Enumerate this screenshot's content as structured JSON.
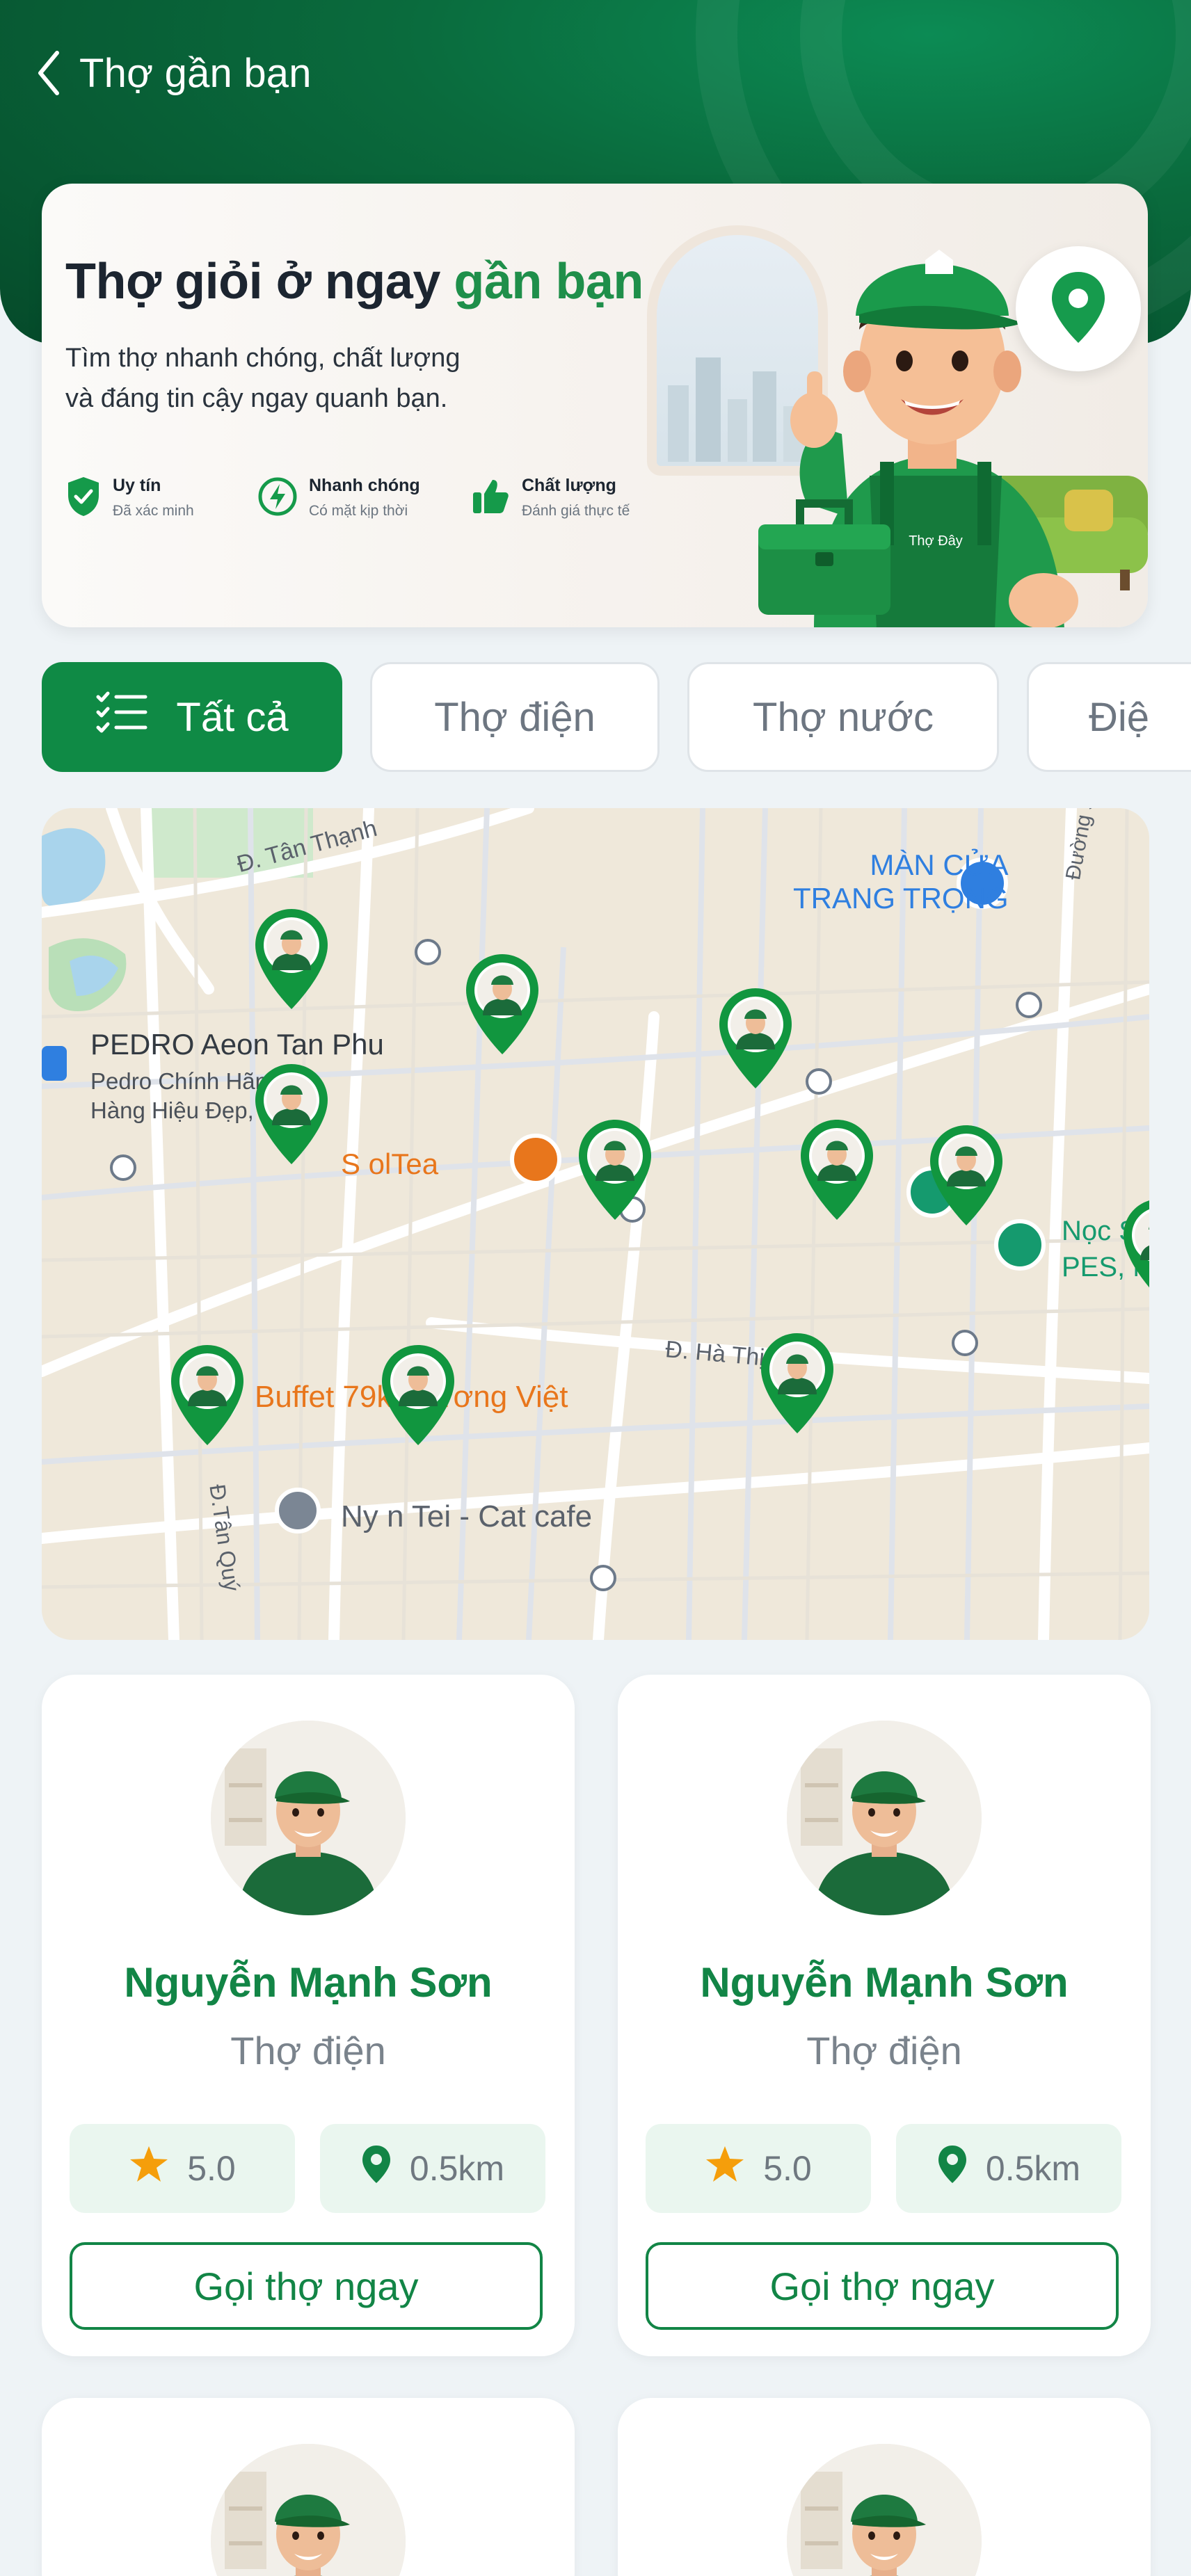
{
  "header": {
    "title": "Thợ gần bạn"
  },
  "banner": {
    "title_part1": "Thợ giỏi ở ngay ",
    "title_highlight": "gần bạn",
    "subtitle_line1": "Tìm thợ nhanh chóng, chất lượng",
    "subtitle_line2": "và đáng tin cậy ngay quanh bạn.",
    "features": [
      {
        "title": "Uy tín",
        "desc": "Đã xác minh",
        "icon": "shield-check-icon"
      },
      {
        "title": "Nhanh chóng",
        "desc": "Có mặt kịp thời",
        "icon": "bolt-icon"
      },
      {
        "title": "Chất lượng",
        "desc": "Đánh giá thực tế",
        "icon": "thumbs-up-icon"
      }
    ],
    "shirt_logo": "Thợ Đây"
  },
  "filters": {
    "chips": [
      {
        "label": "Tất cả",
        "active": true
      },
      {
        "label": "Thợ điện",
        "active": false
      },
      {
        "label": "Thợ nước",
        "active": false
      },
      {
        "label": "Điệ",
        "active": false
      }
    ]
  },
  "map": {
    "labels": {
      "street1": "Đ. Tân Thạnh",
      "poi_door_line1": "MÀN CỬA",
      "poi_door_line2": "TRANG TRỌNG",
      "street_right": "Đường s",
      "poi_pedro": "PEDRO Aeon Tan Phu",
      "poi_pedro_sub1": "Pedro Chính Hãng -",
      "poi_pedro_sub2": "Hàng Hiệu Đẹp, Giá ...",
      "poi_tea": "S     olTea",
      "poi_noc1": "Nọc S",
      "poi_noc2": "PES, N",
      "street2": "Đ. Hà Thị Đát",
      "poi_buffet": "Buffet 79k- Hương Việt",
      "street3": "Đ.Tân Quý",
      "poi_cafe": "Ny   n Tei - Cat cafe"
    },
    "colors": {
      "pin": "#11963f",
      "poi_orange": "#e8761c",
      "poi_blue": "#2f7fe0",
      "poi_teal": "#159a6e"
    }
  },
  "workers": [
    {
      "name": "Nguyễn Mạnh Sơn",
      "role": "Thợ điện",
      "rating": "5.0",
      "distance": "0.5km",
      "cta": "Gọi thợ ngay"
    },
    {
      "name": "Nguyễn Mạnh Sơn",
      "role": "Thợ điện",
      "rating": "5.0",
      "distance": "0.5km",
      "cta": "Gọi thợ ngay"
    },
    {
      "name": "",
      "role": "",
      "rating": "",
      "distance": "",
      "cta": ""
    },
    {
      "name": "",
      "role": "",
      "rating": "",
      "distance": "",
      "cta": ""
    }
  ],
  "theme": {
    "brand_green": "#0f8a45",
    "header_green": "#0a6b3d",
    "star": "#f59e0b"
  }
}
